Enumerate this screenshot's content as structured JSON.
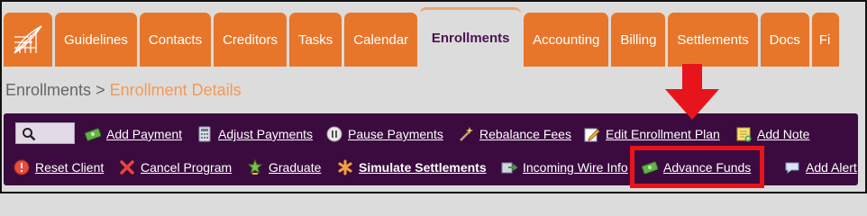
{
  "tabs": [
    {
      "label": "Guidelines"
    },
    {
      "label": "Contacts"
    },
    {
      "label": "Creditors"
    },
    {
      "label": "Tasks"
    },
    {
      "label": "Calendar"
    },
    {
      "label": "Enrollments"
    },
    {
      "label": "Accounting"
    },
    {
      "label": "Billing"
    },
    {
      "label": "Settlements"
    },
    {
      "label": "Docs"
    },
    {
      "label": "Fi"
    }
  ],
  "active_tab": "Enrollments",
  "breadcrumb": {
    "parent": "Enrollments",
    "separator": ">",
    "current": "Enrollment Details"
  },
  "toolbar": {
    "row1": [
      {
        "label": "Add Payment",
        "icon": "money-icon"
      },
      {
        "label": "Adjust Payments",
        "icon": "calculator-icon"
      },
      {
        "label": "Pause Payments",
        "icon": "pause-icon"
      },
      {
        "label": "Rebalance Fees",
        "icon": "magic-wand-icon"
      },
      {
        "label": "Edit Enrollment Plan",
        "icon": "edit-icon"
      },
      {
        "label": "Add Note",
        "icon": "note-icon"
      }
    ],
    "row2": [
      {
        "label": "Reset Client",
        "icon": "alert-icon"
      },
      {
        "label": "Cancel Program",
        "icon": "cancel-icon"
      },
      {
        "label": "Graduate",
        "icon": "graduate-icon"
      },
      {
        "label": "Simulate Settlements",
        "icon": "asterisk-icon"
      },
      {
        "label": "Incoming Wire Info",
        "icon": "wire-icon"
      },
      {
        "label": "Advance Funds",
        "icon": "money-icon"
      },
      {
        "label": "Add Alert",
        "icon": "chat-icon"
      }
    ]
  },
  "colors": {
    "tab_orange": "#e8762a",
    "toolbar_purple": "#3b0b3f",
    "breadcrumb_accent": "#f29a58",
    "annotation_red": "#e8141c"
  }
}
